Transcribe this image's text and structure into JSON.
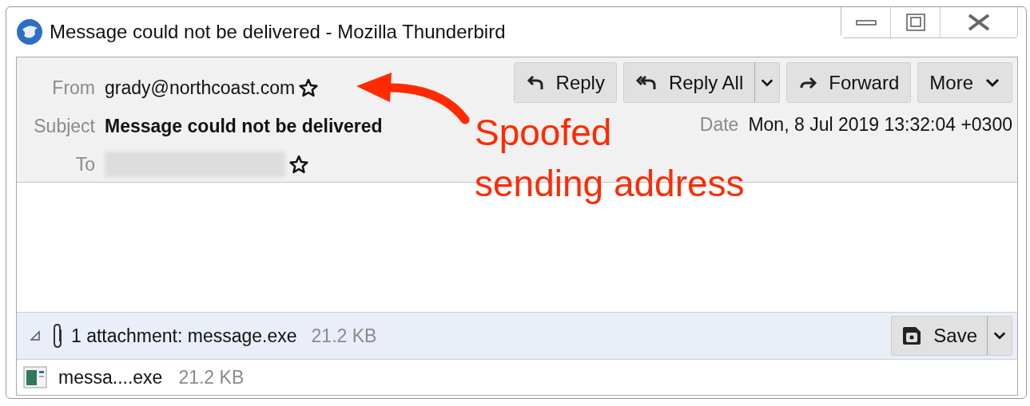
{
  "window": {
    "title": "Message could not be delivered - Mozilla Thunderbird"
  },
  "header": {
    "fields": [
      {
        "label": "From",
        "value": "grady@northcoast.com",
        "kind": "address"
      },
      {
        "label": "Subject",
        "value": "Message could not be delivered",
        "kind": "subject"
      },
      {
        "label": "To",
        "kind": "redacted"
      }
    ],
    "buttons": [
      {
        "label": "Reply",
        "kind": "reply",
        "menu": false
      },
      {
        "label": "Reply All",
        "kind": "reply-all",
        "menu": true
      },
      {
        "label": "Forward",
        "kind": "forward",
        "menu": false
      },
      {
        "label": "More",
        "kind": "more",
        "menu": false
      }
    ],
    "date": {
      "label": "Date",
      "value": "Mon, 8 Jul 2019 13:32:04 +0300"
    }
  },
  "attachments": {
    "expanded": true,
    "summary": "1 attachment: message.exe",
    "size": "21.2 KB",
    "save": "Save",
    "items": [
      {
        "name": "messa....exe",
        "size": "21.2 KB"
      }
    ]
  },
  "annotation": {
    "lines": [
      "Spoofed",
      "sending address"
    ]
  }
}
